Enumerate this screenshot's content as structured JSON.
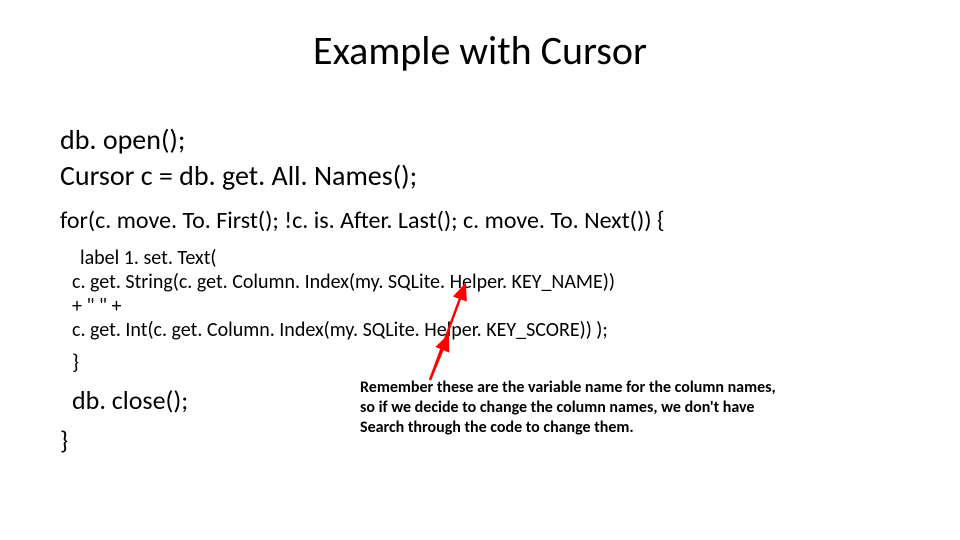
{
  "title": "Example with Cursor",
  "code": {
    "l1": "db. open();",
    "l2": "Cursor c = db. get. All. Names();",
    "l3": "for(c. move. To. First(); !c. is. After. Last(); c. move. To. Next()) {",
    "l4": "label 1. set. Text(",
    "l5": "c. get. String(c. get. Column. Index(my. SQLite. Helper. KEY_NAME))",
    "l6": "+ \" \" +",
    "l7": "c. get. Int(c. get. Column. Index(my. SQLite. Helper. KEY_SCORE)) );",
    "l8": "}",
    "l9": "db. close();",
    "l10": "}"
  },
  "note": {
    "line1": "Remember these are the variable name for the column names,",
    "line2": "so if we decide to change the column names, we don't have",
    "line3": "Search through the code to change them."
  },
  "arrow_color": "#ff0000"
}
